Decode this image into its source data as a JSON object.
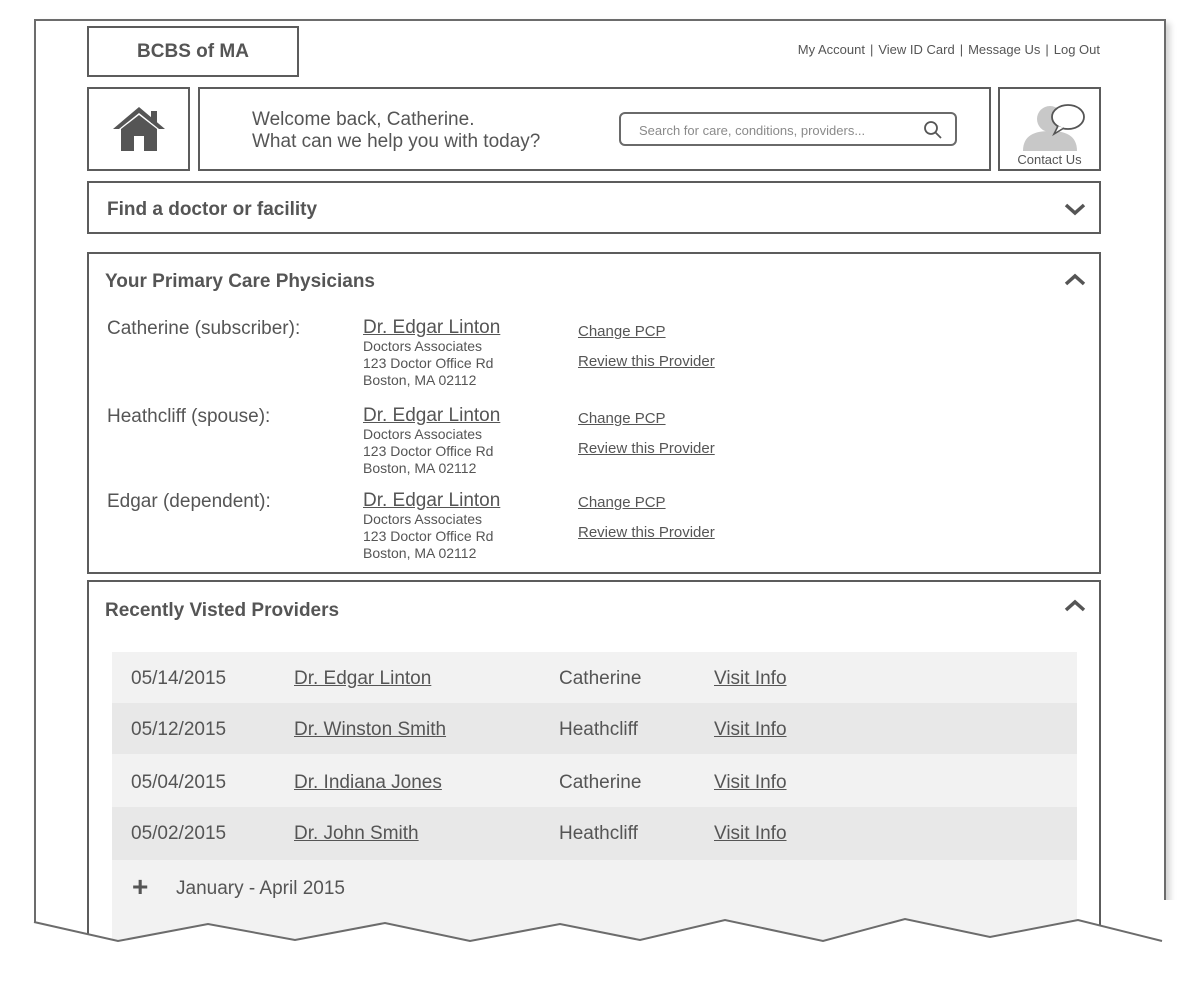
{
  "header": {
    "logo": "BCBS of MA",
    "links": [
      "My Account",
      "View ID Card",
      "Message Us",
      "Log Out"
    ],
    "separators": [
      "|",
      "|",
      "|"
    ]
  },
  "welcome": {
    "line1": "Welcome back, Catherine.",
    "line2": "What can we help you with today?"
  },
  "search": {
    "placeholder": "Search for care, conditions, providers..."
  },
  "contact": {
    "label": "Contact Us"
  },
  "find": {
    "title": "Find a doctor or facility"
  },
  "pcp": {
    "title": "Your Primary Care Physicians",
    "entries": [
      {
        "member": "Catherine (subscriber):",
        "doctor": "Dr. Edgar Linton",
        "practice": "Doctors Associates",
        "street": "123 Doctor Office Rd",
        "city": "Boston, MA 02112",
        "change": "Change PCP",
        "review": "Review this Provider"
      },
      {
        "member": "Heathcliff (spouse):",
        "doctor": "Dr. Edgar Linton",
        "practice": "Doctors Associates",
        "street": "123 Doctor Office Rd",
        "city": "Boston, MA 02112",
        "change": "Change PCP",
        "review": "Review this Provider"
      },
      {
        "member": "Edgar (dependent):",
        "doctor": "Dr. Edgar Linton",
        "practice": "Doctors Associates",
        "street": "123 Doctor Office Rd",
        "city": "Boston, MA 02112",
        "change": "Change PCP",
        "review": "Review this Provider"
      }
    ]
  },
  "recent": {
    "title": "Recently Visted Providers",
    "rows": [
      {
        "date": "05/14/2015",
        "doctor": "Dr. Edgar Linton",
        "member": "Catherine",
        "link": "Visit Info"
      },
      {
        "date": "05/12/2015",
        "doctor": "Dr. Winston Smith",
        "member": "Heathcliff",
        "link": "Visit Info"
      },
      {
        "date": "05/04/2015",
        "doctor": "Dr. Indiana Jones",
        "member": "Catherine",
        "link": "Visit Info"
      },
      {
        "date": "05/02/2015",
        "doctor": "Dr. John Smith",
        "member": "Heathcliff",
        "link": "Visit Info"
      }
    ],
    "groups": [
      {
        "icon": "+",
        "label": "January - April 2015"
      }
    ]
  },
  "icons": {
    "home": "home-icon",
    "search": "search-icon",
    "contact": "contact-person-icon",
    "collapse": "chevron-up-icon",
    "expand": "chevron-down-icon",
    "group": "plus-icon"
  },
  "colors": {
    "outline": "#5c5c5c",
    "text": "#555555",
    "row_light": "#f2f2f2",
    "row_dark": "#e8e8e8"
  }
}
